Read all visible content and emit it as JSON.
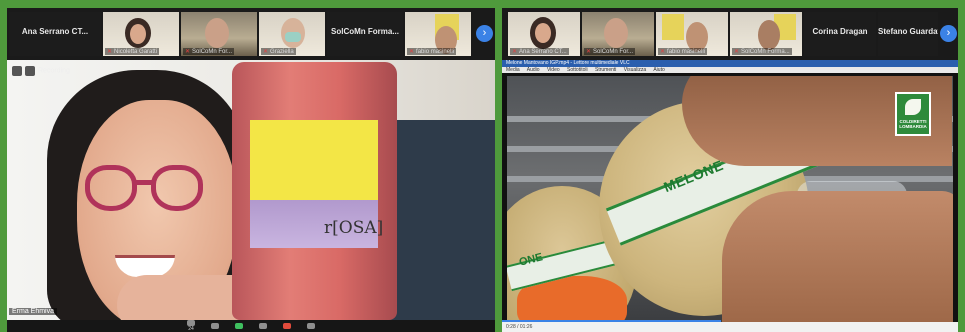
{
  "left_window": {
    "participants": [
      {
        "name": "Ana Serrano CT...",
        "video": false
      },
      {
        "name": "Nicoletta Garatti",
        "video": true
      },
      {
        "name": "SolCoMn For...",
        "video": true
      },
      {
        "name": "Graziella",
        "video": true
      },
      {
        "name": "SolCoMn Forma...",
        "video": false
      },
      {
        "name": "fabio masinelli",
        "video": true
      }
    ],
    "active_speaker_name": "Erma Ehmiva",
    "recording_label": "Recording",
    "bottle_label": "r[OSA]",
    "toolbar": [
      {
        "label": "Participants",
        "count": "24"
      },
      {
        "label": "Chat"
      },
      {
        "label": "Share Screen"
      },
      {
        "label": "Record"
      },
      {
        "label": "Reactions"
      },
      {
        "label": "Leave"
      }
    ]
  },
  "right_window": {
    "participants": [
      {
        "name": "Ana Serrano CT...",
        "video": true
      },
      {
        "name": "SolCoMn For...",
        "video": true
      },
      {
        "name": "fabio masinelli",
        "video": true
      },
      {
        "name": "SolCoMn Forma...",
        "video": true
      },
      {
        "name": "Corina Dragan",
        "video": false
      },
      {
        "name": "Stefano Guardati",
        "video": false
      }
    ],
    "player_title": "Melone Mantovano IGP.mp4 - Lettore multimediale VLC",
    "menu": [
      "Media",
      "Audio",
      "Video",
      "Sottotitoli",
      "Strumenti",
      "Visualizza",
      "Aiuto"
    ],
    "tape_text": "MELONE",
    "tape_text_small": "ONE",
    "brand_lines": [
      "COLDIRETTI",
      "LOMBARDIA"
    ],
    "status_time": "0:28 / 01:26",
    "progress": 0.48
  }
}
